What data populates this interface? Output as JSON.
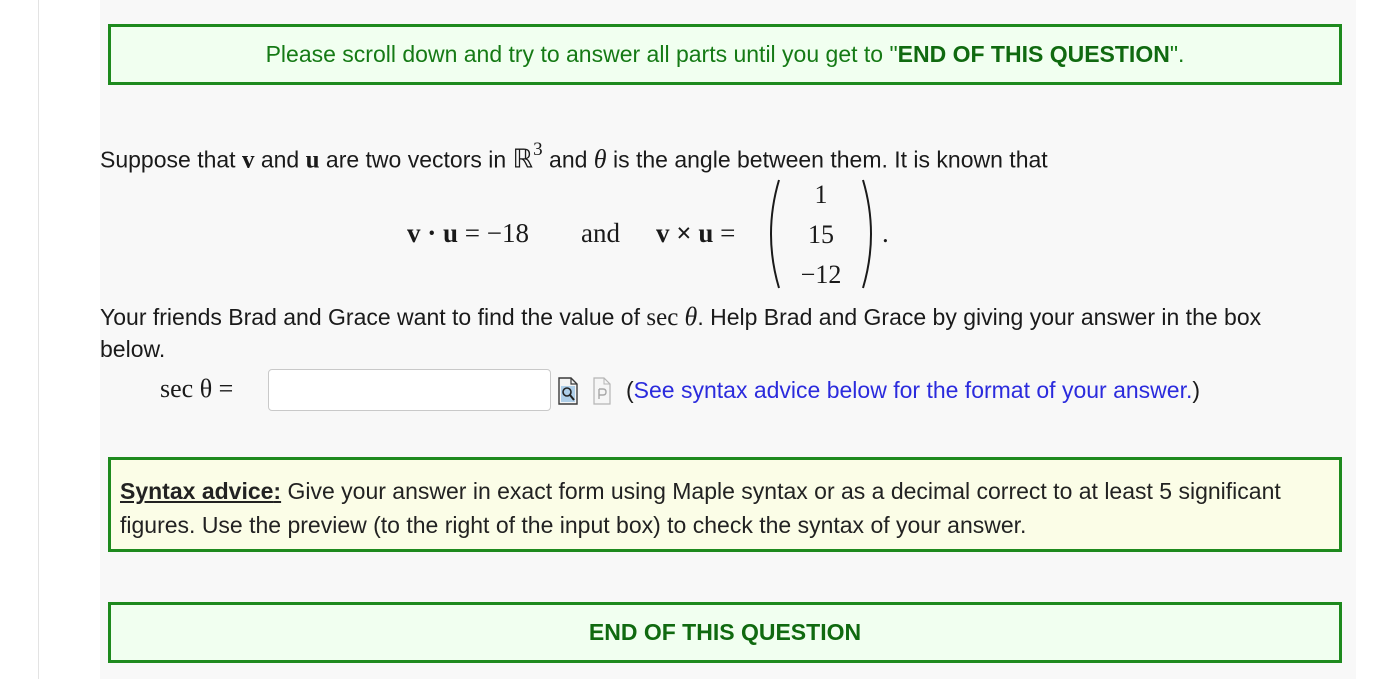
{
  "notice": {
    "prefix": "Please scroll down and try to answer all parts until you get to \"",
    "emphasis": "END OF THIS QUESTION",
    "suffix": "\"."
  },
  "question": {
    "intro_1": "Suppose that ",
    "v": "v",
    "intro_2": " and ",
    "u": "u",
    "intro_3": " are two vectors in ",
    "space": "ℝ",
    "space_exp": "3",
    "intro_4": " and ",
    "theta": "θ",
    "intro_5": " is the angle between them.  It is known that",
    "dot_lhs": "v · u",
    "dot_eq": "= −18",
    "and_word": "and",
    "cross_lhs": "v × u",
    "cross_eq": "=",
    "vector": [
      "1",
      "15",
      "−12"
    ],
    "period": ".",
    "task_1": "Your friends Brad and Grace want to find the value of ",
    "sec": "sec",
    "task_2": ". Help Brad and Grace by giving your answer in the box",
    "task_3": "below."
  },
  "answer": {
    "label": "sec θ =",
    "value": "",
    "placeholder": "",
    "syntax_hint_open": "(",
    "syntax_hint": "See syntax advice below for the format of your answer.",
    "syntax_hint_close": ")"
  },
  "syntax_advice": {
    "title": "Syntax advice",
    "colon": ":",
    "line_1": " Give your answer in exact form using Maple syntax or as a decimal correct to at least 5 significant",
    "line_2": "figures.  Use the preview (to the right of the input box) to check the syntax of your answer."
  },
  "end_notice": "END OF THIS QUESTION",
  "icons": [
    "preview-icon",
    "paste-icon"
  ],
  "colors": {
    "border_green": "#1e8a1e",
    "text_green": "#157a15",
    "link_blue": "#2b2bdd"
  }
}
